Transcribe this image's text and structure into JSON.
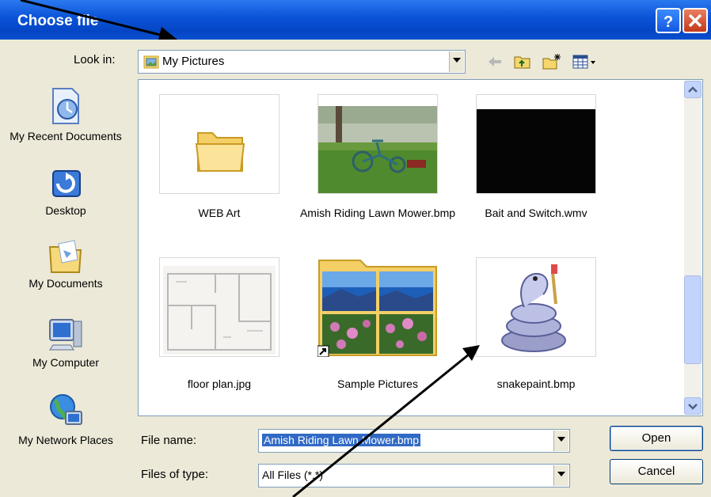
{
  "window": {
    "title": "Choose file"
  },
  "toolbar": {
    "look_in_label": "Look in:",
    "look_in_value": "My Pictures"
  },
  "places": [
    {
      "label": "My Recent Documents"
    },
    {
      "label": "Desktop"
    },
    {
      "label": "My Documents"
    },
    {
      "label": "My Computer"
    },
    {
      "label": "My Network Places"
    }
  ],
  "files": [
    {
      "name": "WEB Art",
      "icon": "folder-icon"
    },
    {
      "name": "Amish Riding Lawn Mower.bmp",
      "icon": "lawn-mower-thumbnail"
    },
    {
      "name": "Bait and Switch.wmv",
      "icon": "video-thumbnail"
    },
    {
      "name": "floor plan.jpg",
      "icon": "floor-plan-thumbnail"
    },
    {
      "name": "Sample Pictures",
      "icon": "folder-thumbnail"
    },
    {
      "name": "snakepaint.bmp",
      "icon": "snake-thumbnail"
    }
  ],
  "form": {
    "file_name_label": "File name:",
    "file_name_value": "Amish Riding Lawn Mower.bmp",
    "file_type_label": "Files of type:",
    "file_type_value": "All Files (*.*)"
  },
  "buttons": {
    "open": "Open",
    "cancel": "Cancel"
  },
  "colors": {
    "titlebar": "#0a53d6",
    "selection": "#316ac5",
    "dialog_bg": "#ece9d8"
  }
}
